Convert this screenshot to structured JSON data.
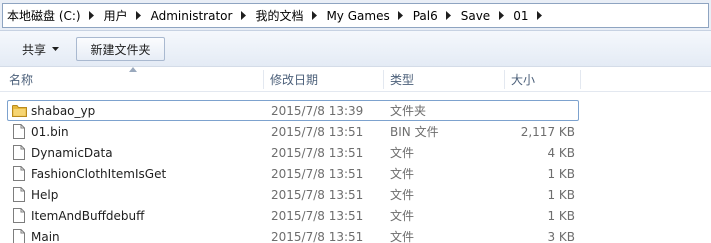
{
  "address_bar": {
    "crumbs": [
      "本地磁盘 (C:)",
      "用户",
      "Administrator",
      "我的文档",
      "My Games",
      "Pal6",
      "Save",
      "01"
    ]
  },
  "toolbar": {
    "share_label": "共享",
    "new_folder_label": "新建文件夹"
  },
  "columns": {
    "name": "名称",
    "date": "修改日期",
    "type": "类型",
    "size": "大小"
  },
  "files": [
    {
      "name": "shabao_yp",
      "date": "2015/7/8 13:39",
      "type": "文件夹",
      "size": "",
      "icon": "folder-icon",
      "selected": true
    },
    {
      "name": "01.bin",
      "date": "2015/7/8 13:51",
      "type": "BIN 文件",
      "size": "2,117 KB",
      "icon": "file-icon"
    },
    {
      "name": "DynamicData",
      "date": "2015/7/8 13:51",
      "type": "文件",
      "size": "4 KB",
      "icon": "file-icon"
    },
    {
      "name": "FashionClothItemIsGet",
      "date": "2015/7/8 13:51",
      "type": "文件",
      "size": "1 KB",
      "icon": "file-icon"
    },
    {
      "name": "Help",
      "date": "2015/7/8 13:51",
      "type": "文件",
      "size": "1 KB",
      "icon": "file-icon"
    },
    {
      "name": "ItemAndBuffdebuff",
      "date": "2015/7/8 13:51",
      "type": "文件",
      "size": "1 KB",
      "icon": "file-icon"
    },
    {
      "name": "Main",
      "date": "2015/7/8 13:51",
      "type": "文件",
      "size": "3 KB",
      "icon": "file-icon"
    }
  ],
  "colors": {
    "selection_border": "#7da2ce",
    "folder_yellow": "#e8b93c",
    "address_bg": "#e9eef6"
  }
}
